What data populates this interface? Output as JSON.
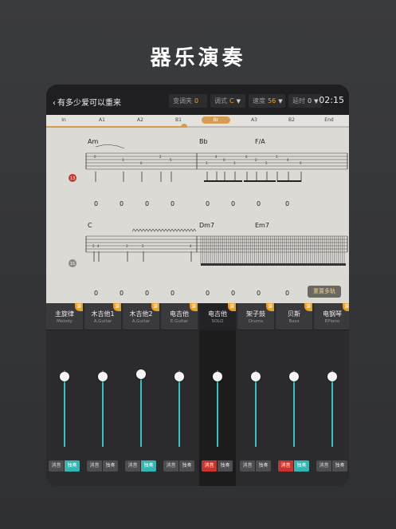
{
  "hero": {
    "title": "器乐演奏"
  },
  "topbar": {
    "back_label": "有多少爱可以重来",
    "capo_label": "变调夹",
    "capo_value": "0",
    "key_label": "调式",
    "key_value": "C",
    "tempo_label": "速度",
    "tempo_value": "56",
    "delay_label": "延时",
    "delay_value": "0",
    "time": "02:15"
  },
  "sections": [
    "In",
    "A1",
    "A2",
    "B1",
    "Br",
    "A3",
    "B2",
    "End"
  ],
  "active_section": "Br",
  "progress": {
    "fraction": 0.455
  },
  "score": {
    "measure_badges": [
      "13",
      "15"
    ],
    "chords_row1": [
      "Am",
      "Bb",
      "F/A"
    ],
    "chords_row2": [
      "C",
      "Dm7",
      "Em7"
    ],
    "tab_zeros_row1": [
      "0",
      "0",
      "0",
      "0",
      "0",
      "0",
      "0",
      "0"
    ],
    "tab_zeros_row2": [
      "0",
      "0",
      "0",
      "0",
      "0",
      "0",
      "0",
      "0"
    ],
    "reset_label": "重置多轨"
  },
  "tracks": [
    {
      "name": "主旋律",
      "sub": "Melody",
      "level": 0.92,
      "mute_on": false,
      "solo_on": true,
      "selected": false
    },
    {
      "name": "木吉他1",
      "sub": "A.Guitar",
      "level": 0.92,
      "mute_on": false,
      "solo_on": false,
      "selected": false
    },
    {
      "name": "木吉他2",
      "sub": "A.Guitar",
      "level": 0.95,
      "mute_on": false,
      "solo_on": true,
      "selected": false
    },
    {
      "name": "电吉他",
      "sub": "E.Guitar",
      "level": 0.92,
      "mute_on": false,
      "solo_on": false,
      "selected": false
    },
    {
      "name": "电吉他",
      "sub": "SOLO",
      "level": 0.92,
      "mute_on": true,
      "solo_on": false,
      "selected": true
    },
    {
      "name": "架子鼓",
      "sub": "Drums",
      "level": 0.92,
      "mute_on": false,
      "solo_on": false,
      "selected": false
    },
    {
      "name": "贝斯",
      "sub": "Bass",
      "level": 0.92,
      "mute_on": true,
      "solo_on": true,
      "selected": false
    },
    {
      "name": "电钢琴",
      "sub": "EPiano",
      "level": 0.92,
      "mute_on": false,
      "solo_on": false,
      "selected": false
    }
  ],
  "labels": {
    "mute": "消音",
    "solo": "独奏",
    "badge": "谱"
  },
  "colors": {
    "accent": "#d69c52",
    "solo": "#2fb7b3",
    "mute": "#c9352d",
    "badge": "#e8a020"
  }
}
